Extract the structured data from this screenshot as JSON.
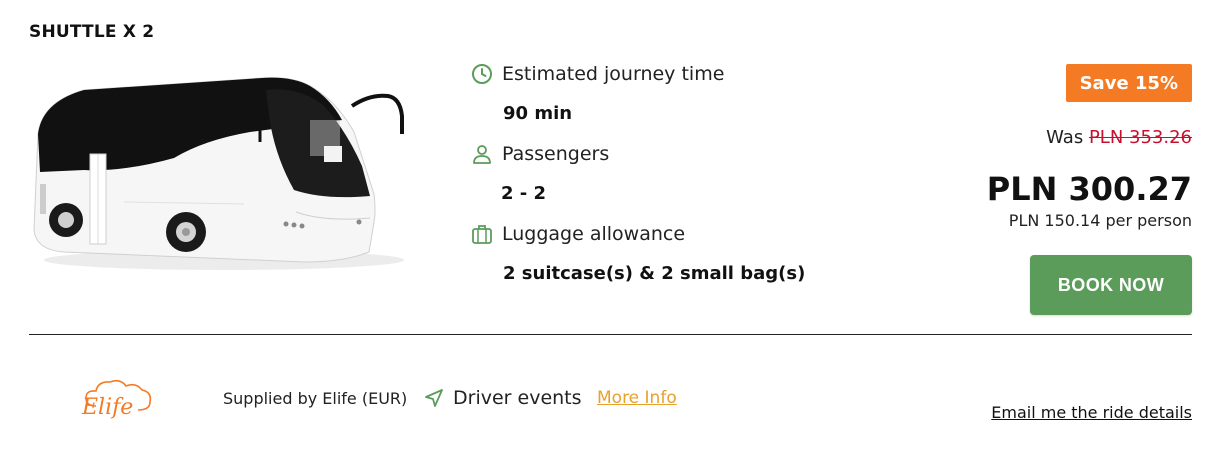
{
  "vehicle": {
    "title": "SHUTTLE X 2",
    "image_icon": "bus-image"
  },
  "details": {
    "journey": {
      "icon": "clock-icon",
      "label": "Estimated journey time",
      "value": "90 min"
    },
    "passengers": {
      "icon": "user-icon",
      "label": "Passengers",
      "value": "2 - 2"
    },
    "luggage": {
      "icon": "suitcase-icon",
      "label": "Luggage allowance",
      "value": "2 suitcase(s) & 2 small bag(s)"
    },
    "icon_color": "#5b9c5b"
  },
  "pricing": {
    "save_badge": "Save 15%",
    "was_label": "Was",
    "was_price": "PLN 353.26",
    "price": "PLN 300.27",
    "per_person": "PLN 150.14 per person",
    "book_label": "BOOK NOW",
    "badge_color": "#f47b24",
    "button_color": "#5b9c5b",
    "strike_color": "#c8102e"
  },
  "footer": {
    "logo_text": "Elife",
    "supplied_by": "Supplied by Elife (EUR)",
    "driver_icon": "navigation-arrow-icon",
    "driver_events": "Driver events",
    "more_info": "More Info",
    "email_link": "Email me the ride details",
    "link_color": "#e8a12b"
  }
}
